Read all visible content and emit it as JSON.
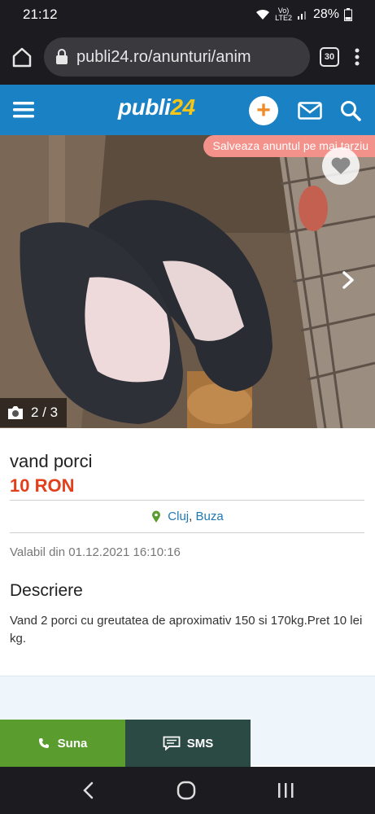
{
  "status": {
    "time": "21:12",
    "signal_top": "Vo)",
    "signal_bottom": "LTE2",
    "battery": "28%"
  },
  "browser": {
    "url": "publi24.ro/anunturi/anim",
    "tab_count": "30"
  },
  "header": {
    "logo_main": "publi",
    "logo_accent": "24",
    "brand_blue": "#1a82c4"
  },
  "gallery": {
    "save_label": "Salveaza anuntul pe mai tarziu",
    "counter": "2 / 3"
  },
  "listing": {
    "title": "vand porci",
    "price": "10 RON",
    "location_city": "Cluj",
    "location_sep": ",",
    "location_area": "Buza",
    "valid_from": "Valabil din 01.12.2021 16:10:16",
    "description_heading": "Descriere",
    "description": "Vand 2 porci cu greutatea de aproximativ 150 si 170kg.Pret 10 lei kg."
  },
  "actions": {
    "call_label": "Suna",
    "sms_label": "SMS",
    "call_color": "#5a9c2e",
    "sms_color": "#2b4a44"
  },
  "icons": [
    "home-icon",
    "lock-icon",
    "more-icon",
    "menu-icon",
    "plus-icon",
    "mail-icon",
    "search-icon",
    "heart-icon",
    "chevron-right-icon",
    "camera-icon",
    "location-pin-icon",
    "phone-icon",
    "sms-icon",
    "back-icon",
    "home-circle-icon",
    "recents-icon"
  ]
}
